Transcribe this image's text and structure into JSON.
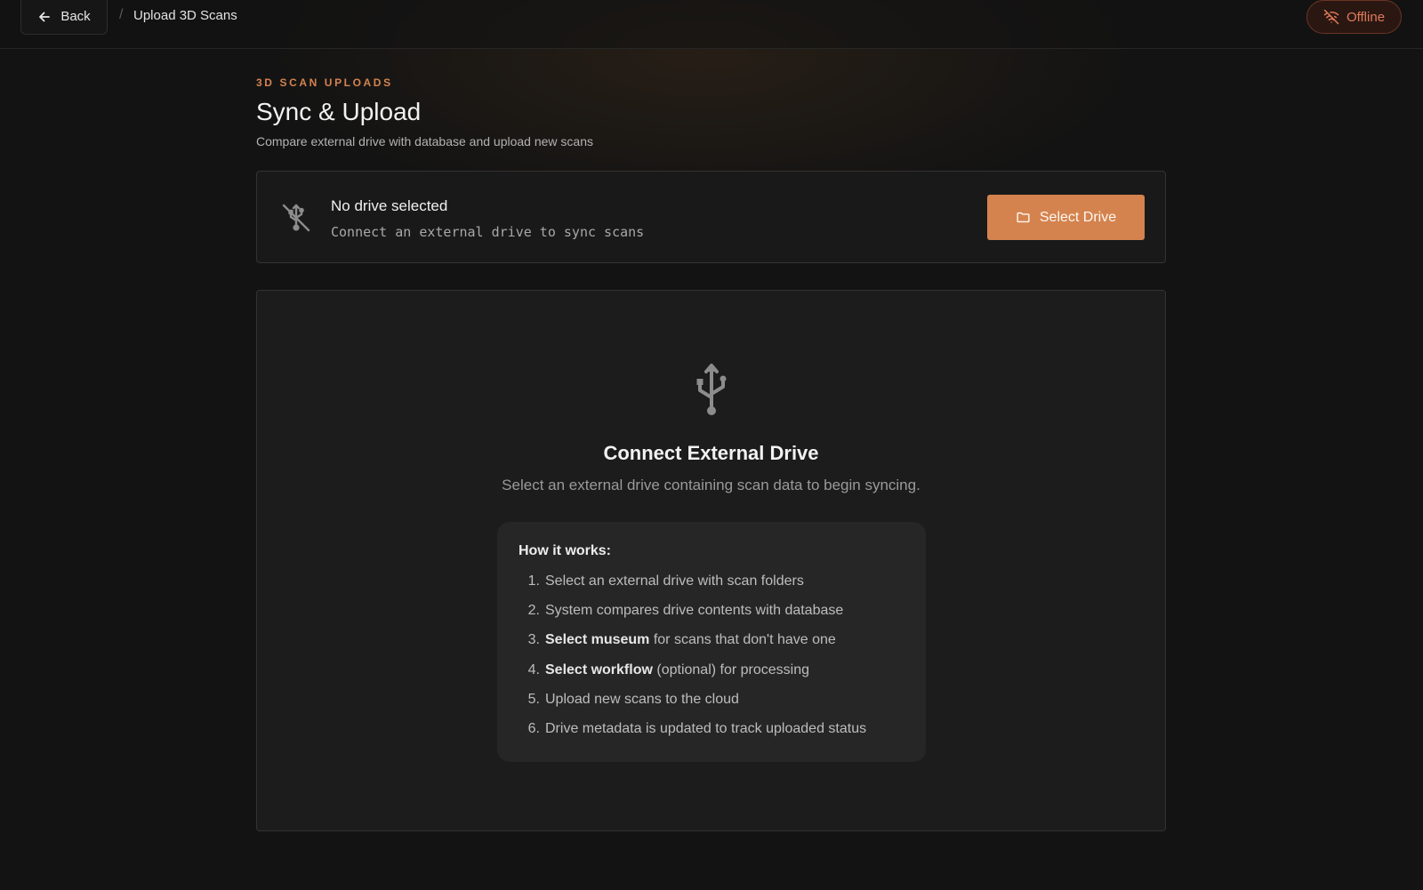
{
  "header": {
    "back_label": "Back",
    "breadcrumb_separator": "/",
    "breadcrumb_title": "Upload 3D Scans",
    "status_label": "Offline"
  },
  "page": {
    "eyebrow": "3D SCAN UPLOADS",
    "title": "Sync & Upload",
    "subtitle": "Compare external drive with database and upload new scans"
  },
  "drive": {
    "status": "No drive selected",
    "hint": "Connect an external drive to sync scans",
    "select_label": "Select Drive"
  },
  "empty_state": {
    "title": "Connect External Drive",
    "subtitle": "Select an external drive containing scan data to begin syncing."
  },
  "how_it_works": {
    "title": "How it works:",
    "steps": [
      {
        "num": "1.",
        "bold": "",
        "text": "Select an external drive with scan folders"
      },
      {
        "num": "2.",
        "bold": "",
        "text": "System compares drive contents with database"
      },
      {
        "num": "3.",
        "bold": "Select museum",
        "text": " for scans that don't have one"
      },
      {
        "num": "4.",
        "bold": "Select workflow",
        "text": " (optional) for processing"
      },
      {
        "num": "5.",
        "bold": "",
        "text": "Upload new scans to the cloud"
      },
      {
        "num": "6.",
        "bold": "",
        "text": "Drive metadata is updated to track uploaded status"
      }
    ]
  },
  "icons": {
    "back": "arrow-left-icon",
    "offline": "wifi-off-icon",
    "no_drive": "usb-off-icon",
    "select_drive": "folder-icon",
    "connect": "usb-icon"
  },
  "colors": {
    "accent": "#d4834f",
    "offline": "#e07a5a",
    "background": "#131313",
    "card": "#1c1c1c"
  }
}
